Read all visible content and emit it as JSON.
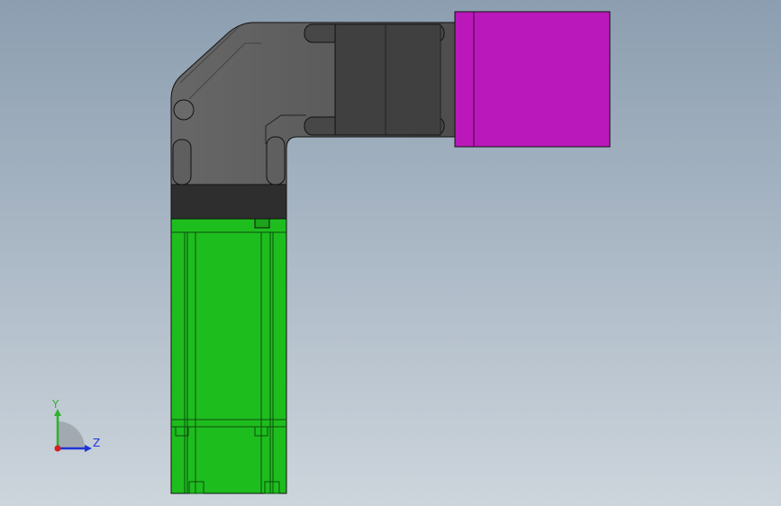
{
  "viewport": {
    "background_top": "#8c9eb0",
    "background_bottom": "#cdd5dc"
  },
  "model": {
    "elbow_color": "#5a5a5a",
    "collar_color": "#2e2e2e",
    "gearbox_color": "#4a4a4a",
    "motor_color": "#1ebd1e",
    "end_cap_color": "#bb18bb",
    "edge_color": "#111111"
  },
  "triad": {
    "y_label": "Y",
    "z_label": "Z",
    "y_color": "#2bb52b",
    "z_color": "#1f35d8",
    "x_color": "#d42020"
  }
}
